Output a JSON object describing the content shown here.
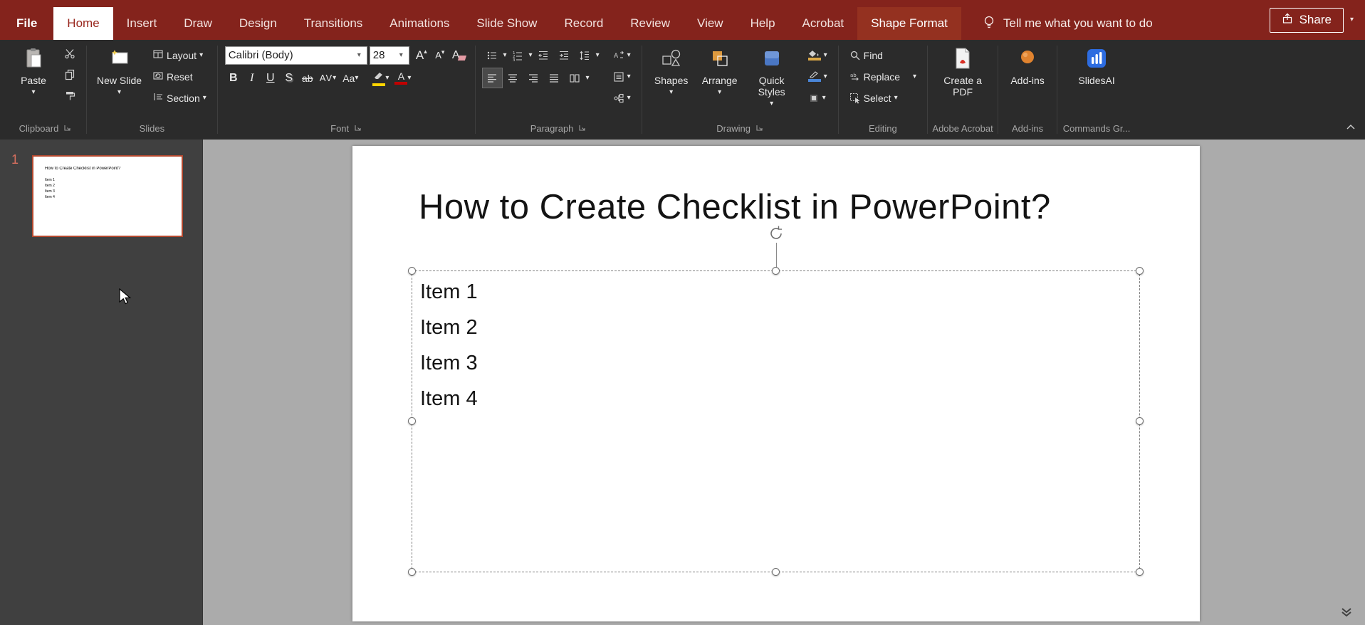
{
  "colors": {
    "titlebar_red": "#84231c",
    "contextual_tab_red": "#943120",
    "selected_tab_text_red": "#99271e",
    "ribbon_bg": "#2b2b2b",
    "panel_bg": "#404040",
    "canvas_bg": "#ababab",
    "thumbnail_border_red": "#b5492f",
    "highlight_yellow": "#ffd400",
    "font_color_red": "#c00000",
    "addins_orange": "#e0832f",
    "slidesai_blue": "#2d6ce0"
  },
  "tabs": [
    {
      "label": "File"
    },
    {
      "label": "Home",
      "selected": true
    },
    {
      "label": "Insert"
    },
    {
      "label": "Draw"
    },
    {
      "label": "Design"
    },
    {
      "label": "Transitions"
    },
    {
      "label": "Animations"
    },
    {
      "label": "Slide Show"
    },
    {
      "label": "Record"
    },
    {
      "label": "Review"
    },
    {
      "label": "View"
    },
    {
      "label": "Help"
    },
    {
      "label": "Acrobat"
    },
    {
      "label": "Shape Format",
      "contextual": true
    }
  ],
  "tell_me": {
    "label": "Tell me what you want to do"
  },
  "share": {
    "label": "Share"
  },
  "ribbon": {
    "clipboard": {
      "group_label": "Clipboard",
      "paste_label": "Paste"
    },
    "slides": {
      "group_label": "Slides",
      "new_slide_label": "New Slide",
      "layout_label": "Layout",
      "reset_label": "Reset",
      "section_label": "Section"
    },
    "font": {
      "group_label": "Font",
      "font_name": "Calibri (Body)",
      "font_size": "28",
      "grow": "A",
      "shrink": "A",
      "clear": "A",
      "bold": "B",
      "italic": "I",
      "underline": "U",
      "shadow": "S",
      "strikethrough": "ab",
      "char_spacing": "AV",
      "change_case": "Aa",
      "font_color_letter": "A"
    },
    "paragraph": {
      "group_label": "Paragraph"
    },
    "drawing": {
      "group_label": "Drawing",
      "shapes_label": "Shapes",
      "arrange_label": "Arrange",
      "quick_styles_label": "Quick Styles"
    },
    "editing": {
      "group_label": "Editing",
      "find_label": "Find",
      "replace_label": "Replace",
      "select_label": "Select"
    },
    "acrobat": {
      "group_label": "Adobe Acrobat",
      "create_pdf_label": "Create a PDF"
    },
    "addins": {
      "group_label": "Add-ins",
      "button_label": "Add-ins"
    },
    "slidesai": {
      "group_label": "Commands Gr...",
      "button_label": "SlidesAI"
    }
  },
  "slides_panel": {
    "slide_number": "1"
  },
  "slide": {
    "title": "How to Create Checklist in PowerPoint?",
    "items": [
      "Item 1",
      "Item 2",
      "Item 3",
      "Item 4"
    ],
    "title_font_size_pt": "40",
    "body_font_size_pt": "28"
  }
}
